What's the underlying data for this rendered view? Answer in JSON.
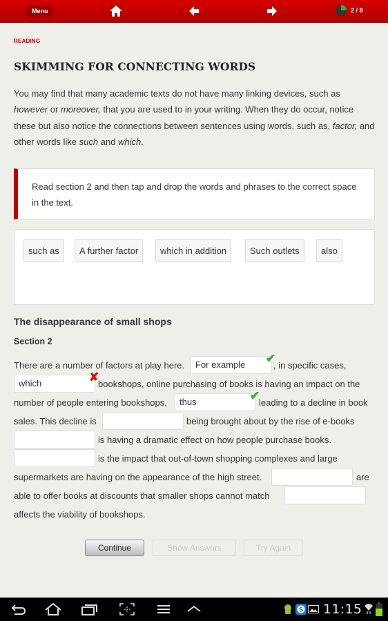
{
  "topbar": {
    "menu_label": "Menu",
    "home_icon": "home-icon",
    "back_icon": "arrow-left-icon",
    "forward_icon": "arrow-right-icon",
    "progress_text": "2 / 8",
    "progress_fraction": 0.25,
    "brand_color": "#c00000"
  },
  "section_label": "READING",
  "page_title": "SKIMMING FOR CONNECTING WORDS",
  "intro": {
    "p1": "You may find that many academic texts do not have many linking devices, such as",
    "i1": "however",
    "p2": " or ",
    "i2": "moreover,",
    "p3": " that you are used to in your writing. When they do occur, notice these but also notice the connections between sentences using words, such as, ",
    "i3": "factor,",
    "p4": " and other words like ",
    "i4": "such",
    "p5": " and ",
    "i5": "which",
    "p6": "."
  },
  "instruction": "Read section 2 and then tap and drop the words and phrases to the correct space in the text.",
  "word_bank": [
    "such as",
    "A further factor",
    "which in addition",
    "Such outlets",
    "also"
  ],
  "article": {
    "title": "The disappearance of small shops",
    "section": "Section 2",
    "lines": [
      "There are a number of factors at play here.",
      ", in specific cases,",
      "bookshops, online purchasing of books is having an impact on the",
      "number of people entering bookshops,",
      "leading to a decline in book",
      "sales. This decline is",
      "being brought about by the rise of e-books",
      "is having a dramatic effect on how people purchase books.",
      "is the impact that out-of-town shopping complexes and large",
      "supermarkets are having on the appearance of the high street.",
      "are",
      "able to offer books at discounts that smaller shops cannot match",
      "affects the viability of bookshops."
    ],
    "blanks": [
      {
        "value": "For example",
        "status": "correct"
      },
      {
        "value": "which",
        "status": "incorrect"
      },
      {
        "value": "thus",
        "status": "correct"
      },
      {
        "value": "",
        "status": "empty"
      },
      {
        "value": "",
        "status": "empty"
      },
      {
        "value": "",
        "status": "empty"
      },
      {
        "value": "",
        "status": "empty"
      },
      {
        "value": "",
        "status": "empty"
      }
    ],
    "check_mark": "✔",
    "cross_mark": "✘"
  },
  "buttons": {
    "continue": "Continue",
    "show_answers": "Show Answers",
    "try_again": "Try Again"
  },
  "system_bar": {
    "clock": "11:15",
    "icons": [
      "back-icon",
      "home-icon",
      "recent-apps-icon",
      "screenshot-icon",
      "menu-icon",
      "up-chevron-icon",
      "android-icon",
      "skype-icon",
      "gallery-icon",
      "wifi-icon",
      "battery-icon"
    ]
  }
}
